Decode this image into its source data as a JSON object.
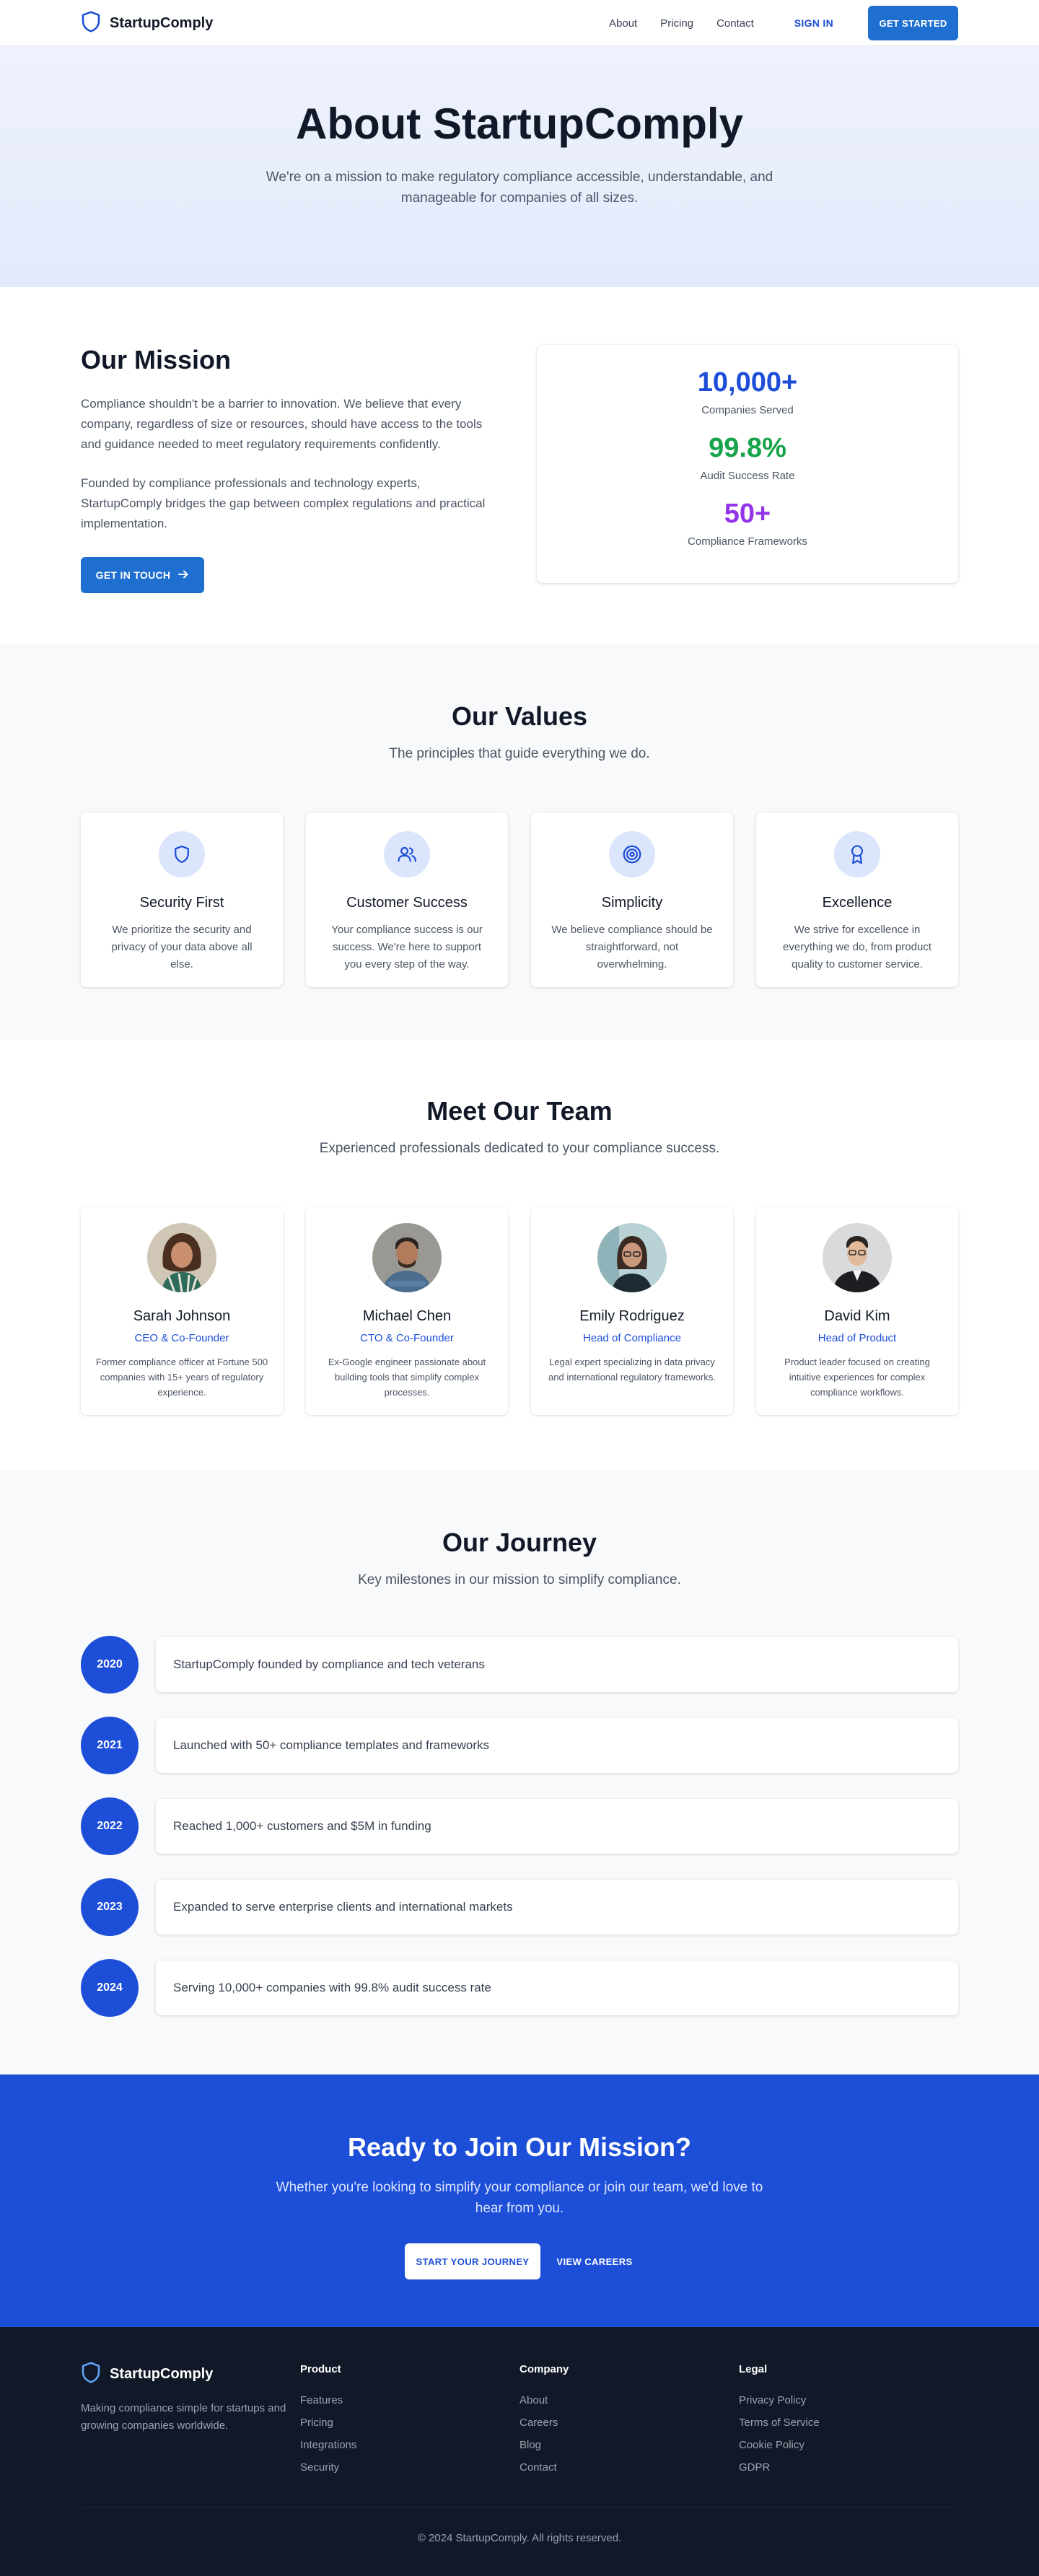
{
  "nav": {
    "brand": "StartupComply",
    "links": [
      "About",
      "Pricing",
      "Contact"
    ],
    "sign_in": "SIGN IN",
    "get_started": "GET STARTED"
  },
  "hero": {
    "title": "About StartupComply",
    "subtitle": "We're on a mission to make regulatory compliance accessible, understandable, and manageable for companies of all sizes."
  },
  "mission": {
    "title": "Our Mission",
    "paragraph1": "Compliance shouldn't be a barrier to innovation. We believe that every company, regardless of size or resources, should have access to the tools and guidance needed to meet regulatory requirements confidently.",
    "paragraph2": "Founded by compliance professionals and technology experts, StartupComply bridges the gap between complex regulations and practical implementation.",
    "cta": "GET IN TOUCH",
    "stats": [
      {
        "value": "10,000+",
        "label": "Companies Served",
        "color": "#1d4ed8"
      },
      {
        "value": "99.8%",
        "label": "Audit Success Rate",
        "color": "#16a34a"
      },
      {
        "value": "50+",
        "label": "Compliance Frameworks",
        "color": "#9333ea"
      }
    ]
  },
  "values": {
    "title": "Our Values",
    "subtitle": "The principles that guide everything we do.",
    "items": [
      {
        "icon": "shield-icon",
        "title": "Security First",
        "text": "We prioritize the security and privacy of your data above all else."
      },
      {
        "icon": "people-icon",
        "title": "Customer Success",
        "text": "Your compliance success is our success. We're here to support you every step of the way."
      },
      {
        "icon": "target-icon",
        "title": "Simplicity",
        "text": "We believe compliance should be straightforward, not overwhelming."
      },
      {
        "icon": "award-icon",
        "title": "Excellence",
        "text": "We strive for excellence in everything we do, from product quality to customer service."
      }
    ]
  },
  "team": {
    "title": "Meet Our Team",
    "subtitle": "Experienced professionals dedicated to your compliance success.",
    "members": [
      {
        "name": "Sarah Johnson",
        "role": "CEO & Co-Founder",
        "bio": "Former compliance officer at Fortune 500 companies with 15+ years of regulatory experience."
      },
      {
        "name": "Michael Chen",
        "role": "CTO & Co-Founder",
        "bio": "Ex-Google engineer passionate about building tools that simplify complex processes."
      },
      {
        "name": "Emily Rodriguez",
        "role": "Head of Compliance",
        "bio": "Legal expert specializing in data privacy and international regulatory frameworks."
      },
      {
        "name": "David Kim",
        "role": "Head of Product",
        "bio": "Product leader focused on creating intuitive experiences for complex compliance workflows."
      }
    ]
  },
  "journey": {
    "title": "Our Journey",
    "subtitle": "Key milestones in our mission to simplify compliance.",
    "milestones": [
      {
        "year": "2020",
        "text": "StartupComply founded by compliance and tech veterans"
      },
      {
        "year": "2021",
        "text": "Launched with 50+ compliance templates and frameworks"
      },
      {
        "year": "2022",
        "text": "Reached 1,000+ customers and $5M in funding"
      },
      {
        "year": "2023",
        "text": "Expanded to serve enterprise clients and international markets"
      },
      {
        "year": "2024",
        "text": "Serving 10,000+ companies with 99.8% audit success rate"
      }
    ]
  },
  "cta": {
    "title": "Ready to Join Our Mission?",
    "subtitle": "Whether you're looking to simplify your compliance or join our team, we'd love to hear from you.",
    "primary": "START YOUR JOURNEY",
    "secondary": "VIEW CAREERS"
  },
  "footer": {
    "brand": "StartupComply",
    "description": "Making compliance simple for startups and growing companies worldwide.",
    "columns": [
      {
        "heading": "Product",
        "links": [
          "Features",
          "Pricing",
          "Integrations",
          "Security"
        ]
      },
      {
        "heading": "Company",
        "links": [
          "About",
          "Careers",
          "Blog",
          "Contact"
        ]
      },
      {
        "heading": "Legal",
        "links": [
          "Privacy Policy",
          "Terms of Service",
          "Cookie Policy",
          "GDPR"
        ]
      }
    ],
    "copyright": "© 2024 StartupComply. All rights reserved."
  }
}
